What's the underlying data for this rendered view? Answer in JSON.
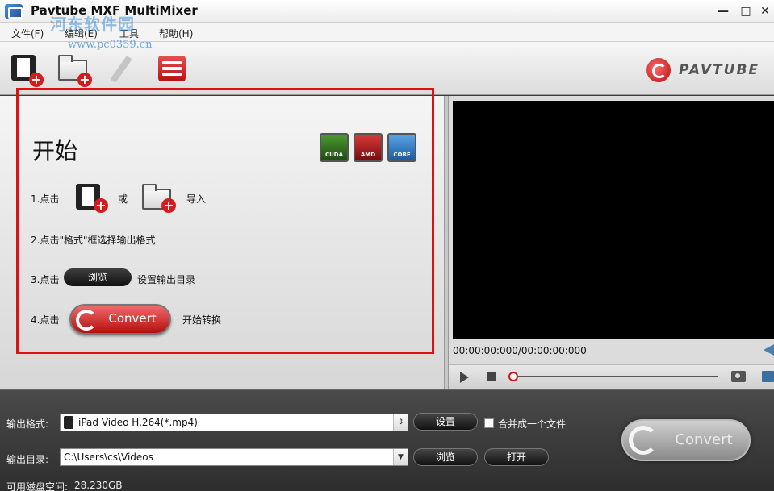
{
  "window": {
    "title": "Pavtube MXF MultiMixer",
    "watermark": "河东软件园",
    "watermark_url": "www.pc0359.cn",
    "minimize": "—",
    "maximize": "□",
    "close": "✕"
  },
  "menu": [
    "文件(F)",
    "编辑(E)",
    "工具",
    "帮助(H)"
  ],
  "brand": {
    "name": "PAVTUBE"
  },
  "getting_started": {
    "title": "开始",
    "badges": [
      {
        "label": "CUDA",
        "color": "#2f6d1f"
      },
      {
        "label": "AMD",
        "color": "#a31717"
      },
      {
        "label": "CORE",
        "color": "#2c7bc8"
      }
    ],
    "step1_prefix": "1.点击",
    "step1_or": "或",
    "step1_suffix": "导入",
    "step2": "2.点击\"格式\"框选择输出格式",
    "step3_prefix": "3.点击",
    "step3_button": "浏览",
    "step3_suffix": "设置输出目录",
    "step4_prefix": "4.点击",
    "step4_button": "Convert",
    "step4_suffix": "开始转换"
  },
  "preview": {
    "timecode": "00:00:00:000/00:00:00:000",
    "progress": 0
  },
  "output": {
    "format_label": "输出格式:",
    "format_value": "iPad Video H.264(*.mp4)",
    "settings_button": "设置",
    "merge_label": "合并成一个文件",
    "merge_checked": false,
    "dir_label": "输出目录:",
    "dir_value": "C:\\Users\\cs\\Videos",
    "browse_button": "浏览",
    "open_button": "打开",
    "disk_label": "可用磁盘空间:",
    "disk_value": "28.230GB",
    "convert_button": "Convert"
  }
}
